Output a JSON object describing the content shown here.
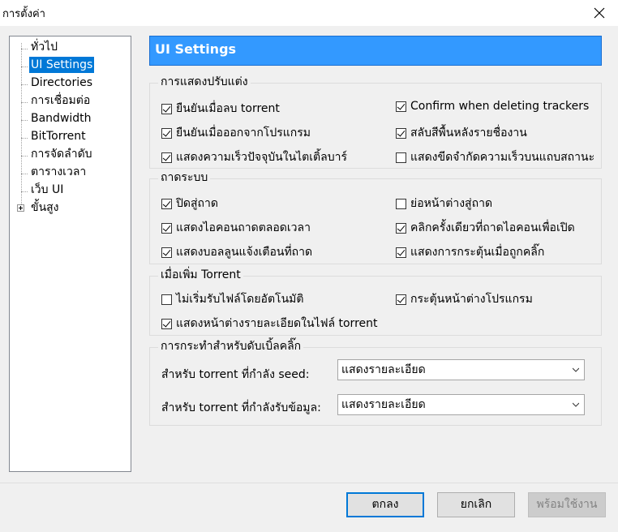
{
  "window": {
    "title": "การตั้งค่า"
  },
  "tree": {
    "items": [
      {
        "label": "ทั่วไป"
      },
      {
        "label": "UI Settings",
        "selected": true
      },
      {
        "label": "Directories"
      },
      {
        "label": "การเชื่อมต่อ"
      },
      {
        "label": "Bandwidth"
      },
      {
        "label": "BitTorrent"
      },
      {
        "label": "การจัดลำดับ"
      },
      {
        "label": "ตารางเวลา"
      },
      {
        "label": "เว็บ UI"
      },
      {
        "label": "ขั้นสูง",
        "expandable": true
      }
    ]
  },
  "page": {
    "heading": "UI Settings"
  },
  "display_group": {
    "title": "การแสดงปรับแต่ง",
    "options": [
      {
        "label": "ยืนยันเมื่อลบ torrent",
        "checked": true
      },
      {
        "label": "Confirm when deleting trackers",
        "checked": true
      },
      {
        "label": "ยืนยันเมื่อออกจากโปรแกรม",
        "checked": true
      },
      {
        "label": "สลับสีพื้นหลังรายชื่องาน",
        "checked": true
      },
      {
        "label": "แสดงความเร็วปัจจุบันในไตเติ้ลบาร์",
        "checked": true
      },
      {
        "label": "แสดงขีดจำกัดความเร็วบนแถบสถานะ",
        "checked": false
      }
    ]
  },
  "tray_group": {
    "title": "ถาดระบบ",
    "options": [
      {
        "label": "ปิดสู่ถาด",
        "checked": true
      },
      {
        "label": "ย่อหน้าต่างสู่ถาด",
        "checked": false
      },
      {
        "label": "แสดงไอคอนถาดตลอดเวลา",
        "checked": true
      },
      {
        "label": "คลิกครั้งเดียวที่ถาดไอคอนเพื่อเปิด",
        "checked": true
      },
      {
        "label": "แสดงบอลลูนแจ้งเตือนที่ถาด",
        "checked": true
      },
      {
        "label": "แสดงการกระตุ้นเมื่อถูกคลิ๊ก",
        "checked": true
      }
    ]
  },
  "add_group": {
    "title": "เมื่อเพิ่ม Torrent",
    "options": [
      {
        "label": "ไม่เริ่มรับไฟล์โดยอัตโนมัติ",
        "checked": false
      },
      {
        "label": "กระตุ้นหน้าต่างโปรแกรม",
        "checked": true
      },
      {
        "label": "แสดงหน้าต่างรายละเอียดในไฟล์ torrent",
        "checked": true
      }
    ]
  },
  "dblclick_group": {
    "title": "การกระทำสำหรับดับเบิ้ลคลิ๊ก",
    "seed_label": "สำหรับ torrent ที่กำลัง seed:",
    "seed_value": "แสดงรายละเอียด",
    "dl_label": "สำหรับ torrent ที่กำลังรับข้อมูล:",
    "dl_value": "แสดงรายละเอียด"
  },
  "buttons": {
    "ok": "ตกลง",
    "cancel": "ยกเลิก",
    "apply": "พร้อมใช้งาน"
  },
  "colors": {
    "accent": "#0078d7",
    "header": "#3399ff"
  }
}
